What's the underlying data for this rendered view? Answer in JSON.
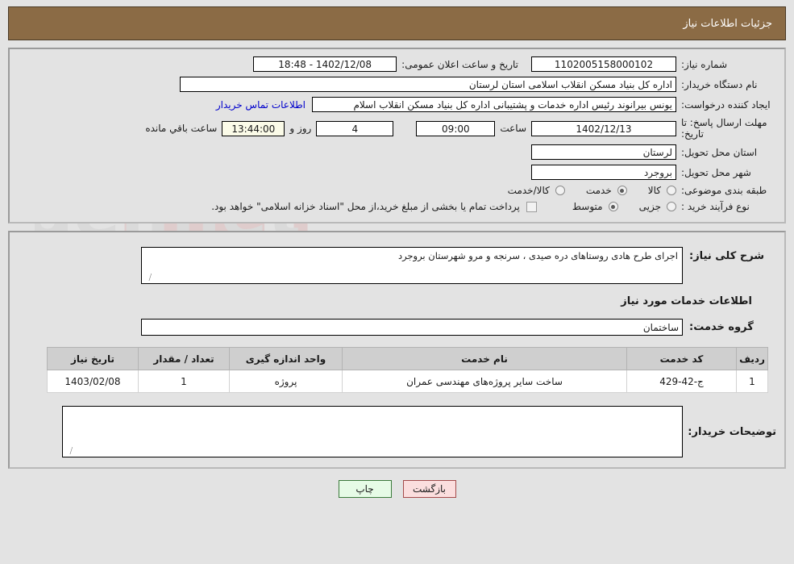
{
  "header": {
    "title": "جزئیات اطلاعات نیاز",
    "bg": "#8b6b45"
  },
  "form": {
    "need_number_label": "شماره نیاز:",
    "need_number_value": "1102005158000102",
    "announce_label": "تاریخ و ساعت اعلان عمومی:",
    "announce_value": "1402/12/08 - 18:48",
    "buyer_org_label": "نام دستگاه خریدار:",
    "buyer_org_value": "اداره کل بنیاد مسکن انقلاب اسلامی استان لرستان",
    "creator_label": "ایجاد کننده درخواست:",
    "creator_value": "یونس بیرانوند رئیس اداره خدمات و پشتیبانی اداره کل بنیاد مسکن انقلاب اسلام",
    "contact_link": "اطلاعات تماس خریدار",
    "deadline_label": "مهلت ارسال پاسخ: تا تاریخ:",
    "deadline_date": "1402/12/13",
    "hour_label": "ساعت",
    "hour_value": "09:00",
    "days_value": "4",
    "days_label": "روز و",
    "remaining_time": "13:44:00",
    "remaining_label": "ساعت باقي مانده",
    "province_label": "استان محل تحویل:",
    "province_value": "لرستان",
    "city_label": "شهر محل تحویل:",
    "city_value": "بروجرد",
    "category_label": "طبقه بندی موضوعی:",
    "category_options": [
      {
        "label": "کالا",
        "selected": false
      },
      {
        "label": "خدمت",
        "selected": true
      },
      {
        "label": "کالا/خدمت",
        "selected": false
      }
    ],
    "process_label": "نوع فرآیند خرید :",
    "process_options": [
      {
        "label": "جزیی",
        "selected": false
      },
      {
        "label": "متوسط",
        "selected": true
      }
    ],
    "treasury_checkbox_label": "پرداخت تمام یا بخشی از مبلغ خرید،از محل \"اسناد خزانه اسلامی\" خواهد بود.",
    "treasury_checked": false
  },
  "description": {
    "label": "شرح کلی نیاز:",
    "value": "اجرای طرح هادی روستاهای دره صیدی ، سرنجه و مرو شهرستان بروجرد"
  },
  "services": {
    "section_title": "اطلاعات خدمات مورد نیاز",
    "group_label": "گروه خدمت:",
    "group_value": "ساختمان",
    "columns": [
      "ردیف",
      "کد خدمت",
      "نام خدمت",
      "واحد اندازه گیری",
      "تعداد / مقدار",
      "تاریخ نیاز"
    ],
    "rows": [
      {
        "row_no": "1",
        "service_code": "ج-42-429",
        "service_name": "ساخت سایر پروژه‌های مهندسی عمران",
        "unit": "پروژه",
        "quantity": "1",
        "need_date": "1403/02/08"
      }
    ]
  },
  "notes": {
    "label": "توضیحات خریدار:",
    "value": ""
  },
  "buttons": {
    "print": "چاپ",
    "back": "بازگشت"
  },
  "watermark": {
    "text": "AriaTender.net"
  }
}
